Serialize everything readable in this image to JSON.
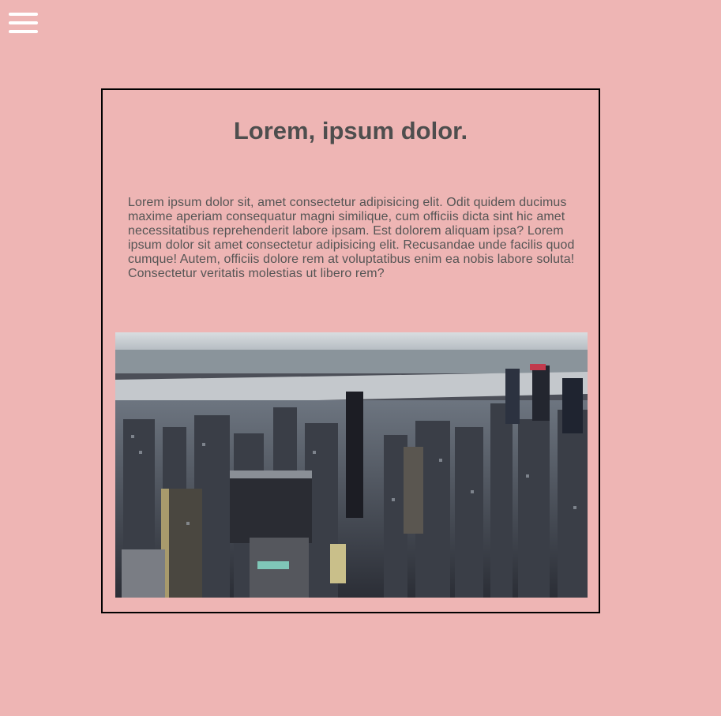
{
  "menu": {
    "icon": "hamburger-menu-icon"
  },
  "card": {
    "title": "Lorem, ipsum dolor.",
    "body": "Lorem ipsum dolor sit, amet consectetur adipisicing elit. Odit quidem ducimus maxime aperiam consequatur magni similique, cum officiis dicta sint hic amet necessitatibus reprehenderit labore ipsam. Est dolorem aliquam ipsa? Lorem ipsum dolor sit amet consectetur adipisicing elit. Recusandae unde facilis quod cumque! Autem, officiis dolore rem at voluptatibus enim ea nobis labore soluta! Consectetur veritatis molestias ut libero rem?"
  },
  "colors": {
    "background": "#eeb5b4",
    "text": "#555555",
    "border": "#000000"
  }
}
